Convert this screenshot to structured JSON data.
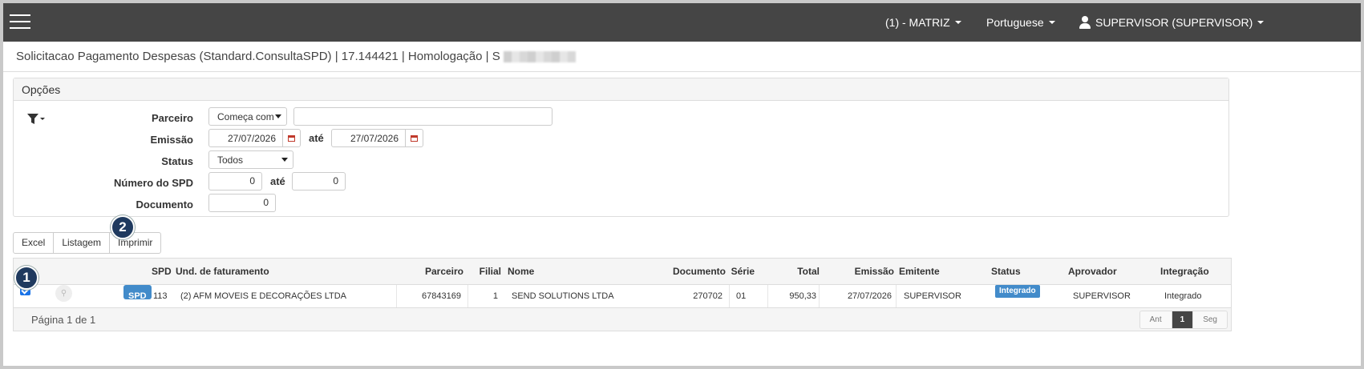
{
  "topbar": {
    "branch": "(1) - MATRIZ",
    "language": "Portuguese",
    "user": "SUPERVISOR (SUPERVISOR)"
  },
  "title": {
    "text": "Solicitacao Pagamento Despesas (Standard.ConsultaSPD) | 17.144421 | Homologação | S"
  },
  "options": {
    "heading": "Opções",
    "parceiro_label": "Parceiro",
    "parceiro_mode": "Começa com",
    "parceiro_value": "",
    "emissao_label": "Emissão",
    "emissao_from": "27/07/2026",
    "emissao_ate": "até",
    "emissao_to": "27/07/2026",
    "status_label": "Status",
    "status_value": "Todos",
    "spd_label": "Número do SPD",
    "spd_from": "0",
    "spd_ate": "até",
    "spd_to": "0",
    "documento_label": "Documento",
    "documento_value": "0"
  },
  "export": {
    "excel": "Excel",
    "listagem": "Listagem",
    "imprimir": "Imprimir"
  },
  "badges": {
    "one": "1",
    "two": "2"
  },
  "table": {
    "headers": {
      "spd": "SPD",
      "und": "Und. de faturamento",
      "parceiro": "Parceiro",
      "filial": "Filial",
      "nome": "Nome",
      "documento": "Documento",
      "serie": "Série",
      "total": "Total",
      "emissao": "Emissão",
      "emitente": "Emitente",
      "status": "Status",
      "aprovador": "Aprovador",
      "integracao": "Integração"
    },
    "rows": [
      {
        "checked": true,
        "spd_button": "SPD",
        "spd": "113",
        "und": "(2) AFM MOVEIS E DECORAÇÕES LTDA",
        "parceiro": "67843169",
        "filial": "1",
        "nome": "SEND SOLUTIONS LTDA",
        "documento": "270702",
        "serie": "01",
        "total": "950,33",
        "emissao": "27/07/2026",
        "emitente": "SUPERVISOR",
        "status": "Integrado",
        "aprovador": "SUPERVISOR",
        "integracao": "Integrado"
      }
    ],
    "page_info": "Página 1 de 1",
    "pager": {
      "prev": "Ant",
      "current": "1",
      "next": "Seg"
    }
  },
  "colors": {
    "topbar": "#454545",
    "accent": "#428bca",
    "badge": "#1f3a5f"
  }
}
